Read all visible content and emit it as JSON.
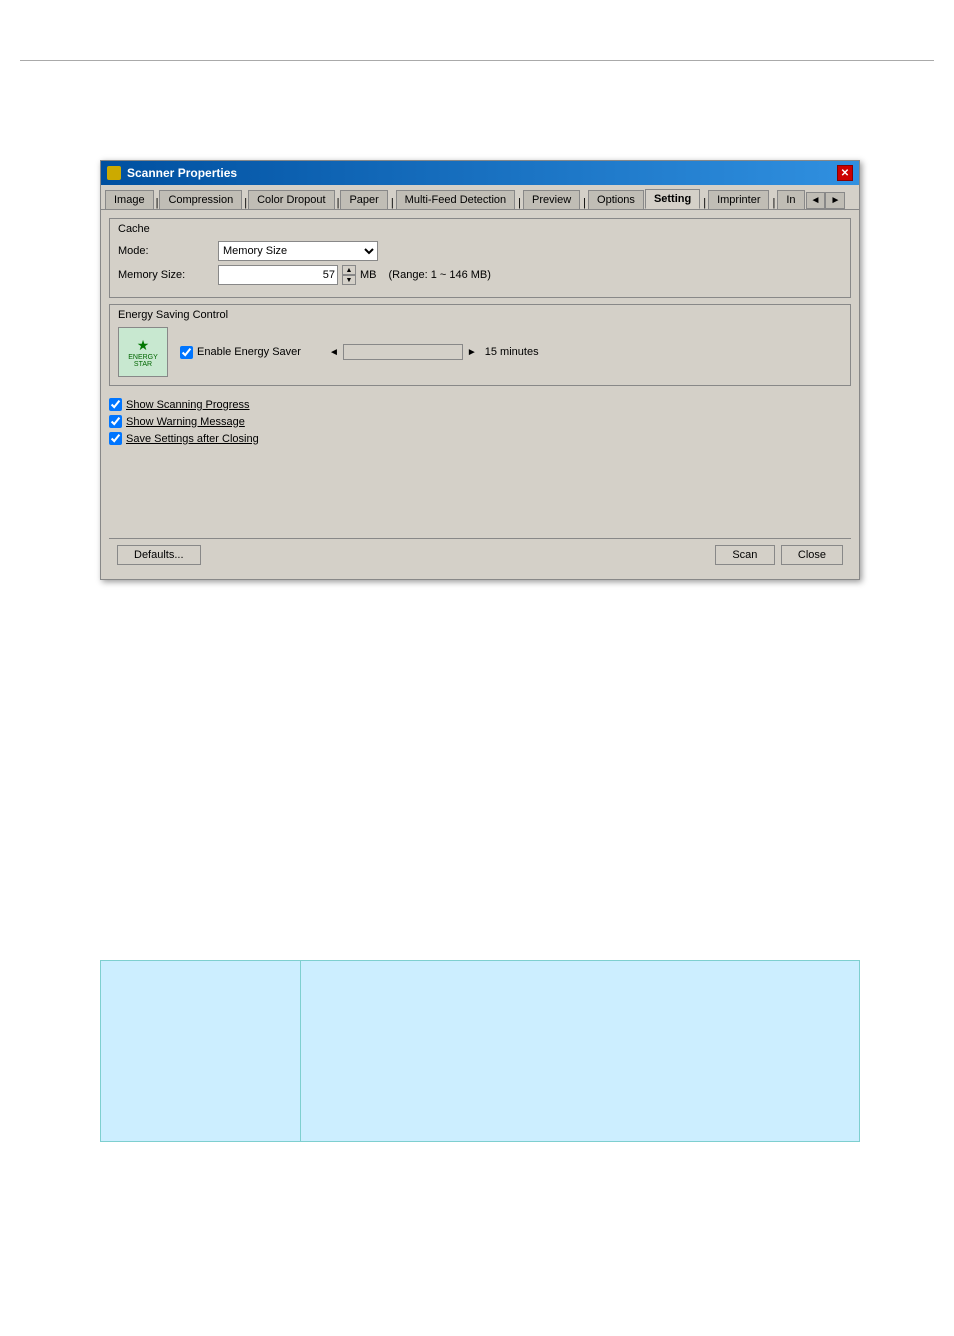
{
  "dialog": {
    "title": "Scanner Properties",
    "close_btn": "✕",
    "tabs": [
      {
        "label": "Image",
        "active": false
      },
      {
        "label": "Compression",
        "active": false
      },
      {
        "label": "Color Dropout",
        "active": false
      },
      {
        "label": "Paper",
        "active": false
      },
      {
        "label": "Multi-Feed Detection",
        "active": false
      },
      {
        "label": "Preview",
        "active": false
      },
      {
        "label": "Options",
        "active": false
      },
      {
        "label": "Setting",
        "active": true
      },
      {
        "label": "Imprinter",
        "active": false
      },
      {
        "label": "In",
        "active": false
      }
    ],
    "cache_section": {
      "title": "Cache",
      "mode_label": "Mode:",
      "mode_value": "Memory Size",
      "memory_size_label": "Memory Size:",
      "memory_size_value": "57",
      "memory_size_unit": "MB",
      "memory_range": "(Range: 1 ~ 146 MB)"
    },
    "energy_section": {
      "title": "Energy Saving Control",
      "logo_text": "ENERGY STAR",
      "enable_label": "Enable Energy Saver",
      "minutes_label": "15 minutes"
    },
    "checkboxes": [
      {
        "label": "Show Scanning Progress",
        "checked": true,
        "underline": true
      },
      {
        "label": "Show Warning Message",
        "checked": true,
        "underline": false
      },
      {
        "label": "Save Settings after Closing",
        "checked": true,
        "underline": false
      }
    ],
    "footer": {
      "defaults_btn": "Defaults...",
      "scan_btn": "Scan",
      "close_btn": "Close"
    }
  },
  "icons": {
    "scanner": "🖨",
    "arrow_left": "◄",
    "arrow_right": "►",
    "spin_up": "▲",
    "spin_down": "▼",
    "tab_prev": "◄",
    "tab_next": "►"
  }
}
